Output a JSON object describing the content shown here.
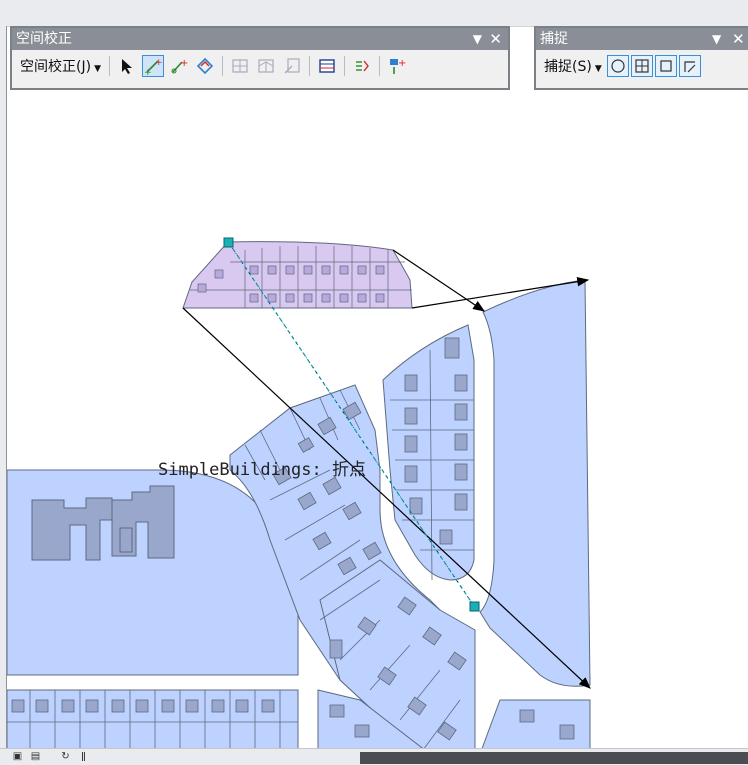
{
  "spatial_adjust_toolbar": {
    "title": "空间校正",
    "menu_label": "空间校正(J)",
    "tools": [
      {
        "icon": "select-arrow-icon"
      },
      {
        "icon": "new-displacement-link-icon"
      },
      {
        "icon": "modify-link-icon"
      },
      {
        "icon": "multiple-displacement-links-icon"
      },
      {
        "icon": "new-identity-link-icon"
      },
      {
        "icon": "new-limited-adjustment-area-icon"
      },
      {
        "icon": "clear-limited-adjustment-area-icon"
      },
      {
        "icon": "view-link-table-icon"
      },
      {
        "icon": "attribute-transfer-icon"
      },
      {
        "icon": "edge-match-icon"
      }
    ]
  },
  "snapping_toolbar": {
    "title": "捕捉",
    "menu_label": "捕捉(S)",
    "tools": [
      {
        "icon": "point-snap-icon"
      },
      {
        "icon": "end-snap-icon"
      },
      {
        "icon": "vertex-snap-icon"
      },
      {
        "icon": "edge-snap-icon"
      }
    ]
  },
  "map": {
    "snap_tip": "SimpleBuildings: 折点",
    "colors": {
      "parcel_fill": "#bed2ff",
      "parcel_stroke": "#5c6a80",
      "building_fill": "#9aa7cc",
      "selected_fill": "#d9c8ef",
      "road": "#ffffff",
      "link_line": "#000000",
      "dashed_link": "#00a0b0"
    }
  },
  "statusbar": {
    "icons": [
      "layout-view-icon",
      "data-view-icon",
      "refresh-icon",
      "pause-icon"
    ]
  }
}
